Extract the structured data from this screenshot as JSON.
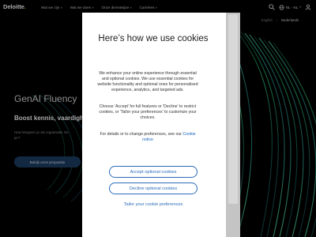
{
  "brand": {
    "logo_text": "Deloitte",
    "logo_dot": "."
  },
  "nav": {
    "items": [
      {
        "label": "Wat we zijn"
      },
      {
        "label": "Wat we doen"
      },
      {
        "label": "Onze dienstwijze"
      },
      {
        "label": "Carrières"
      }
    ],
    "locale": "NL - NL"
  },
  "language_switch": {
    "left": "English",
    "separator": "|",
    "right": "Nederlands"
  },
  "hero": {
    "title": "GenAI Fluency",
    "subtitle": "Boost kennis, vaardigh",
    "body": "How integreer je als organisatie Ge",
    "body_tail": "jer?",
    "body_right": "le?",
    "cta": "Bekijk onze propositie"
  },
  "cookie_modal": {
    "title": "Here’s how we use cookies",
    "paragraph1": "We enhance your online experience through essential and optional cookies. We use essential cookies for website functionality and optional ones for personalised experience, analytics, and targeted ads.",
    "paragraph2": "Choose 'Accept' for full features or 'Decline' to restrict cookies, or 'Tailor your preferences' to customize your choices.",
    "paragraph3_prefix": "For details or to change preferences, see our ",
    "paragraph3_link": "Cookie notice",
    "accept_label": "Accept optional cookies",
    "decline_label": "Decline optional cookies",
    "tailor_label": "Tailor your cookie preferences"
  },
  "colors": {
    "accent_green": "#86bc25",
    "button_blue": "#2b6cb8",
    "cta_bg": "#1e3f66"
  },
  "icons": [
    "chevron-down-icon",
    "search-icon",
    "globe-icon",
    "user-icon"
  ]
}
